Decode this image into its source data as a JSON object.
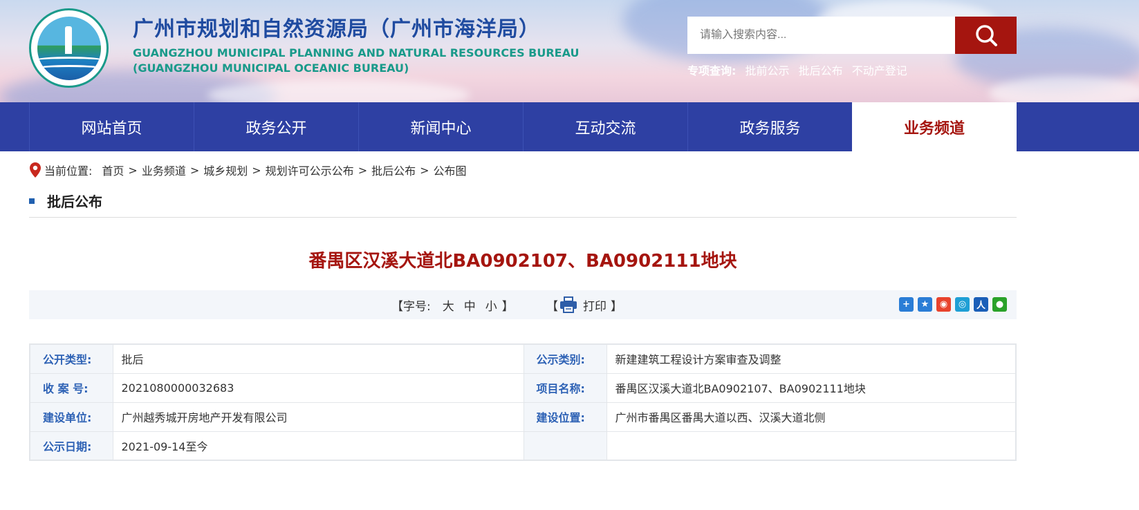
{
  "header": {
    "title_cn": "广州市规划和自然资源局（广州市海洋局）",
    "title_en_1": "GUANGZHOU MUNICIPAL PLANNING AND NATURAL RESOURCES BUREAU",
    "title_en_2": "(GUANGZHOU MUNICIPAL OCEANIC BUREAU)",
    "search_placeholder": "请输入搜索内容...",
    "special_label": "专项查询:",
    "special_links": [
      "批前公示",
      "批后公布",
      "不动产登记"
    ]
  },
  "nav": {
    "items": [
      "网站首页",
      "政务公开",
      "新闻中心",
      "互动交流",
      "政务服务",
      "业务频道"
    ],
    "active": "业务频道"
  },
  "breadcrumb": {
    "label": "当前位置:",
    "items": [
      "首页",
      "业务频道",
      "城乡规划",
      "规划许可公示公布",
      "批后公布",
      "公布图"
    ],
    "separator": ">"
  },
  "section": {
    "title": "批后公布"
  },
  "document": {
    "title": "番禺区汉溪大道北BA0902107、BA0902111地块"
  },
  "toolbar": {
    "font_label": "【字号:",
    "font_options": [
      "大",
      "中",
      "小"
    ],
    "font_close": "】",
    "print_open": "【",
    "print_label": "打印",
    "print_close": "】",
    "share_colors": [
      "#2a7dd6",
      "#2a7dd6",
      "#e8432d",
      "#1f9fd5",
      "#1b5fb8",
      "#2aa22a"
    ]
  },
  "info": {
    "rows": [
      [
        {
          "k": "公开类型:",
          "v": "批后"
        },
        {
          "k": "公示类别:",
          "v": "新建建筑工程设计方案审查及调整"
        }
      ],
      [
        {
          "k": "收 案 号:",
          "v": "2021080000032683"
        },
        {
          "k": "项目名称:",
          "v": "番禺区汉溪大道北BA0902107、BA0902111地块"
        }
      ],
      [
        {
          "k": "建设单位:",
          "v": "广州越秀城开房地产开发有限公司"
        },
        {
          "k": "建设位置:",
          "v": "广州市番禺区番禺大道以西、汉溪大道北侧"
        }
      ],
      [
        {
          "k": "公示日期:",
          "v": "2021-09-14至今"
        },
        {
          "k": "",
          "v": ""
        }
      ]
    ]
  }
}
